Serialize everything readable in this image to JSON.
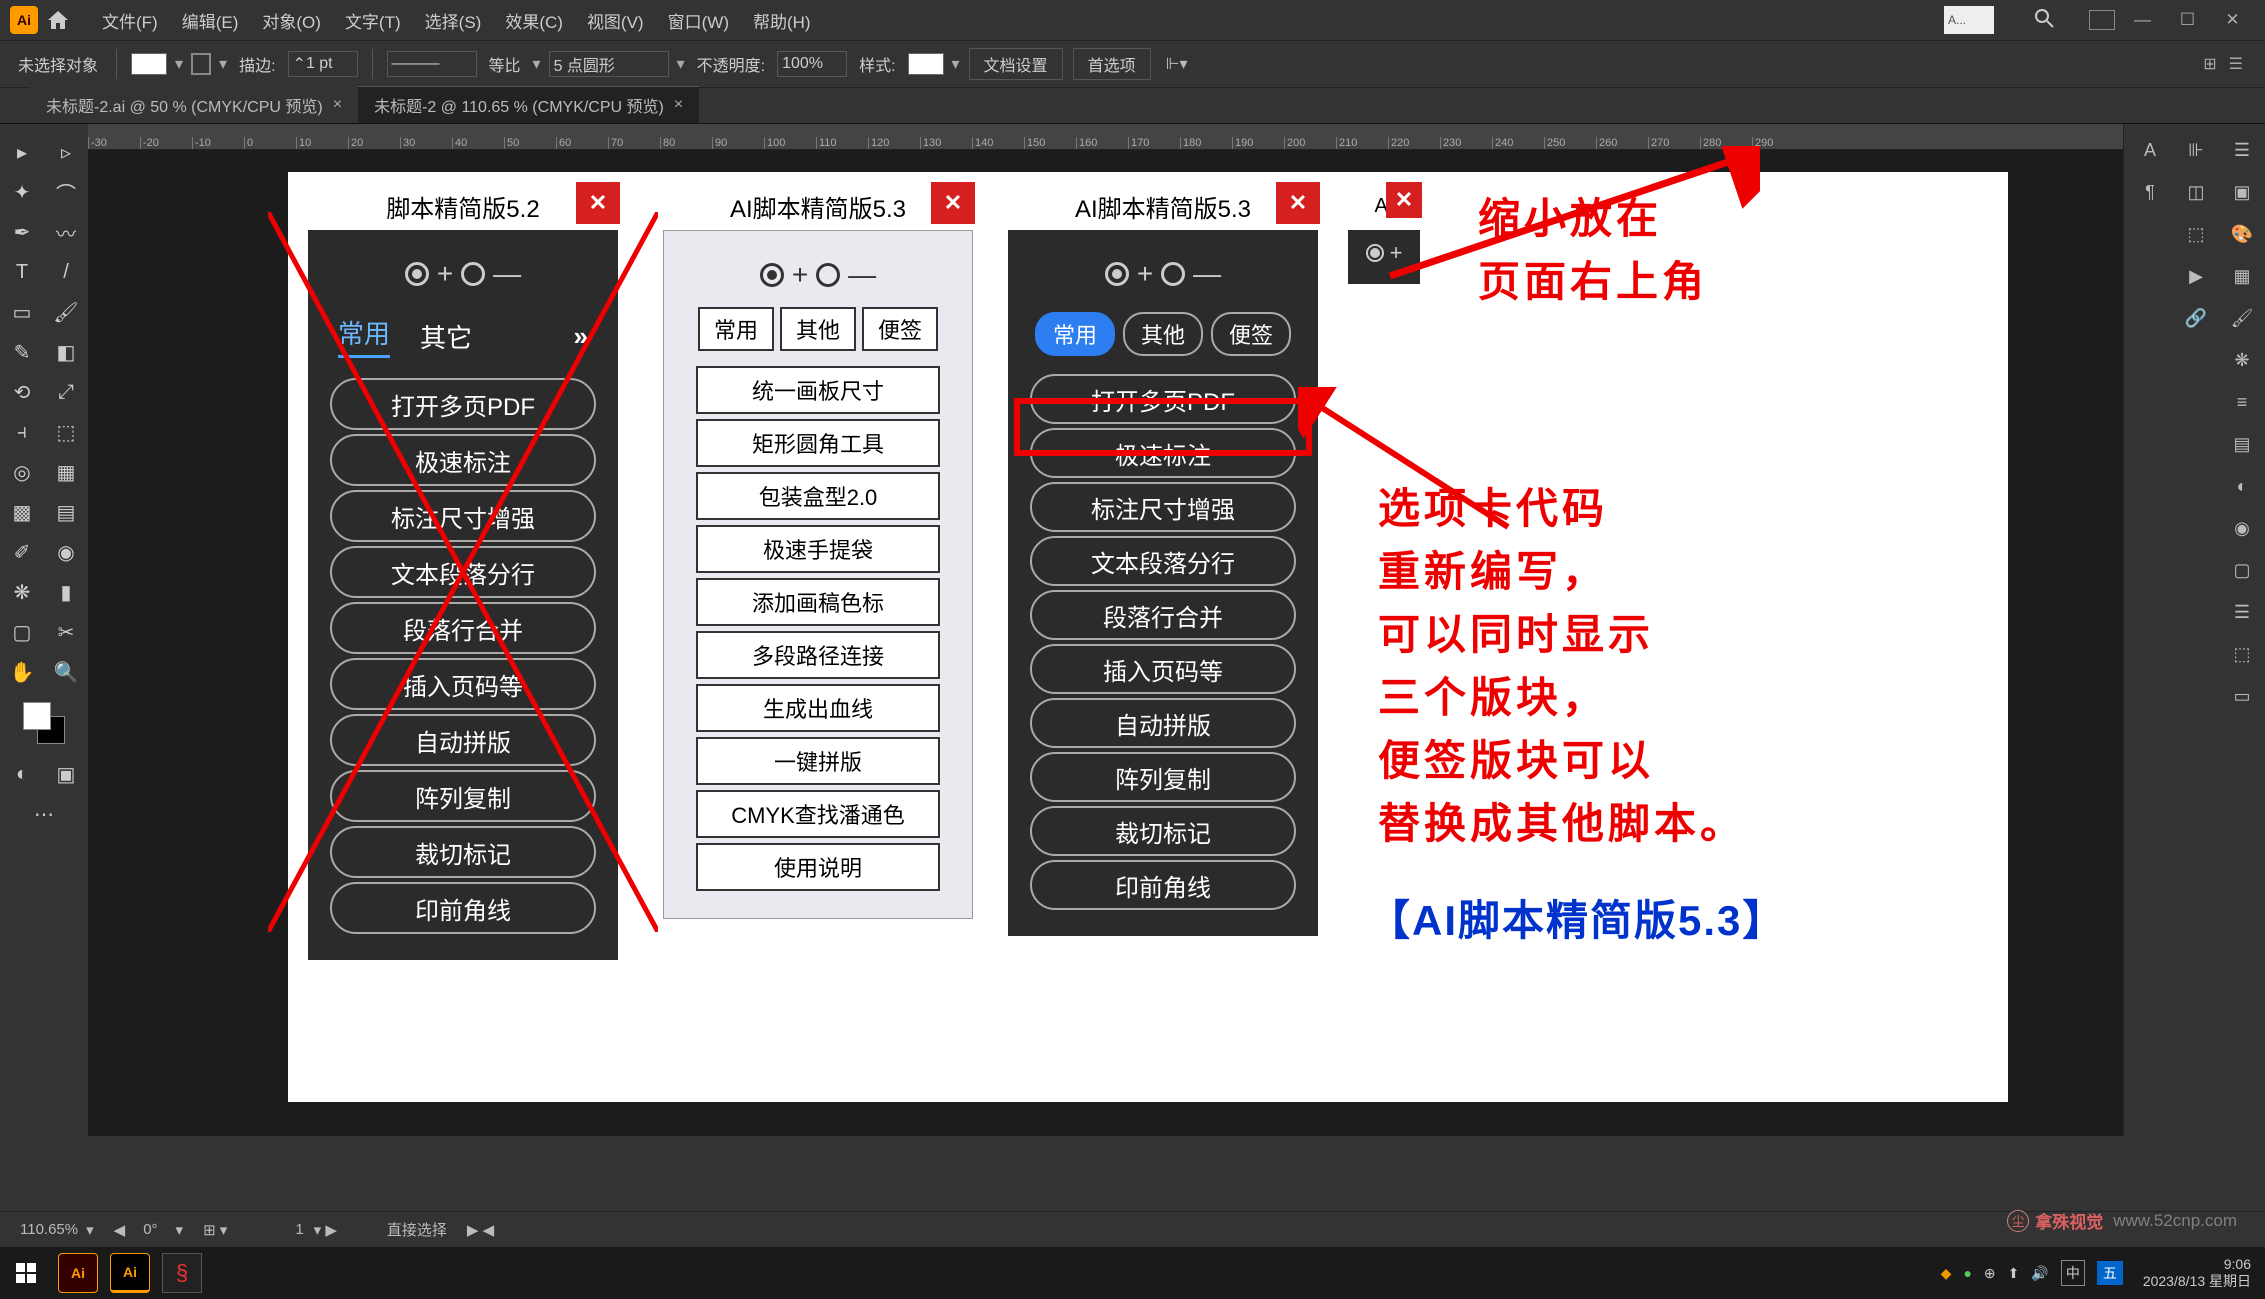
{
  "menubar": {
    "items": [
      "文件(F)",
      "编辑(E)",
      "对象(O)",
      "文字(T)",
      "选择(S)",
      "效果(C)",
      "视图(V)",
      "窗口(W)",
      "帮助(H)"
    ],
    "search_placeholder": "A..."
  },
  "optbar": {
    "no_selection": "未选择对象",
    "stroke_label": "描边:",
    "stroke_value": "1 pt",
    "uniform": "等比",
    "profile": "5 点圆形",
    "opacity_label": "不透明度:",
    "opacity_value": "100%",
    "style_label": "样式:",
    "doc_setup": "文档设置",
    "prefs": "首选项"
  },
  "tabs": {
    "tab1": "未标题-2.ai @ 50 % (CMYK/CPU 预览)",
    "tab2": "未标题-2 @ 110.65 % (CMYK/CPU 预览)"
  },
  "ruler_marks": [
    "-30",
    "-20",
    "-10",
    "0",
    "10",
    "20",
    "30",
    "40",
    "50",
    "60",
    "70",
    "80",
    "90",
    "100",
    "110",
    "120",
    "130",
    "140",
    "150",
    "160",
    "170",
    "180",
    "190",
    "200",
    "210",
    "220",
    "230",
    "240",
    "250",
    "260",
    "270",
    "280",
    "290"
  ],
  "panel1": {
    "title": "脚本精简版5.2",
    "tabs": {
      "a": "常用",
      "b": "其它",
      "more": "»"
    },
    "btns": [
      "打开多页PDF",
      "极速标注",
      "标注尺寸增强",
      "文本段落分行",
      "段落行合并",
      "插入页码等",
      "自动拼版",
      "阵列复制",
      "裁切标记",
      "印前角线"
    ]
  },
  "panel2": {
    "title": "AI脚本精简版5.3",
    "tabs": {
      "a": "常用",
      "b": "其他",
      "c": "便签"
    },
    "btns": [
      "统一画板尺寸",
      "矩形圆角工具",
      "包装盒型2.0",
      "极速手提袋",
      "添加画稿色标",
      "多段路径连接",
      "生成出血线",
      "一键拼版",
      "CMYK查找潘通色",
      "使用说明"
    ]
  },
  "panel3": {
    "title": "AI脚本精简版5.3",
    "tabs": {
      "a": "常用",
      "b": "其他",
      "c": "便签"
    },
    "btns": [
      "打开多页PDF",
      "极速标注",
      "标注尺寸增强",
      "文本段落分行",
      "段落行合并",
      "插入页码等",
      "自动拼版",
      "阵列复制",
      "裁切标记",
      "印前角线"
    ]
  },
  "panel4": {
    "title": "A."
  },
  "annotations": {
    "top1": "缩小放在",
    "top2": "页面右上角",
    "mid": "选项卡代码\n重新编写，\n可以同时显示\n三个版块，\n便签版块可以\n替换成其他脚本。",
    "bottom": "【AI脚本精简版5.3】"
  },
  "statusbar": {
    "zoom": "110.65%",
    "tool_hint": "直接选择"
  },
  "taskbar": {
    "time": "9:06",
    "date": "2023/8/13 星期日"
  },
  "watermark": "www.52cnp.com",
  "ime_text": "中"
}
